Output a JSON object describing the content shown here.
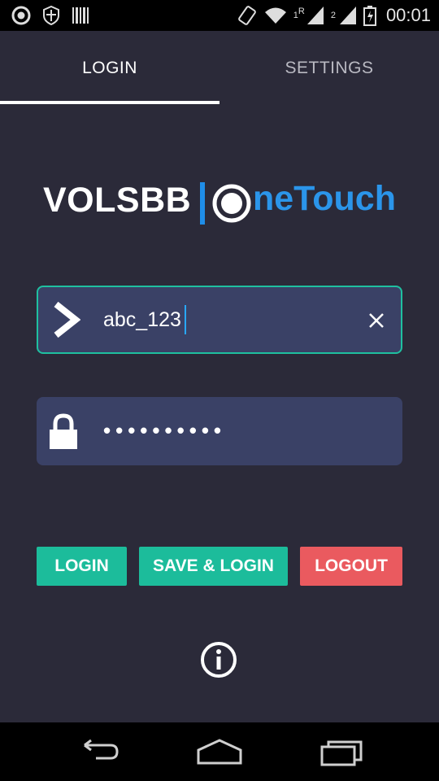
{
  "status_bar": {
    "time": "00:01",
    "sim1_label": "1",
    "roaming_label": "R",
    "sim2_label": "2",
    "icons": [
      "circle-icon",
      "shield-icon",
      "barcode-icon",
      "rotate-icon",
      "wifi-icon",
      "signal-icon",
      "signal-icon",
      "battery-icon"
    ]
  },
  "tabs": [
    {
      "label": "LOGIN",
      "active": true
    },
    {
      "label": "SETTINGS",
      "active": false
    }
  ],
  "logo": {
    "brand": "VOLSBB",
    "product_suffix": "neTouch",
    "colors": {
      "brand": "#ffffff",
      "product": "#2b95ea"
    }
  },
  "form": {
    "username": {
      "value": "abc_123",
      "icon": "chevron-right-icon",
      "clear_icon": "close-icon"
    },
    "password": {
      "masked_value": "••••••••••",
      "icon": "lock-icon"
    }
  },
  "buttons": {
    "login": "LOGIN",
    "save_login": "SAVE & LOGIN",
    "logout": "LOGOUT"
  },
  "colors": {
    "background": "#2b2a39",
    "field": "#3a4166",
    "accent_green": "#1cbc9b",
    "accent_red": "#ea5a5f",
    "focus_border": "#1fc0a0"
  },
  "nav_bar": {
    "icons": [
      "back-icon",
      "home-icon",
      "recents-icon"
    ]
  }
}
